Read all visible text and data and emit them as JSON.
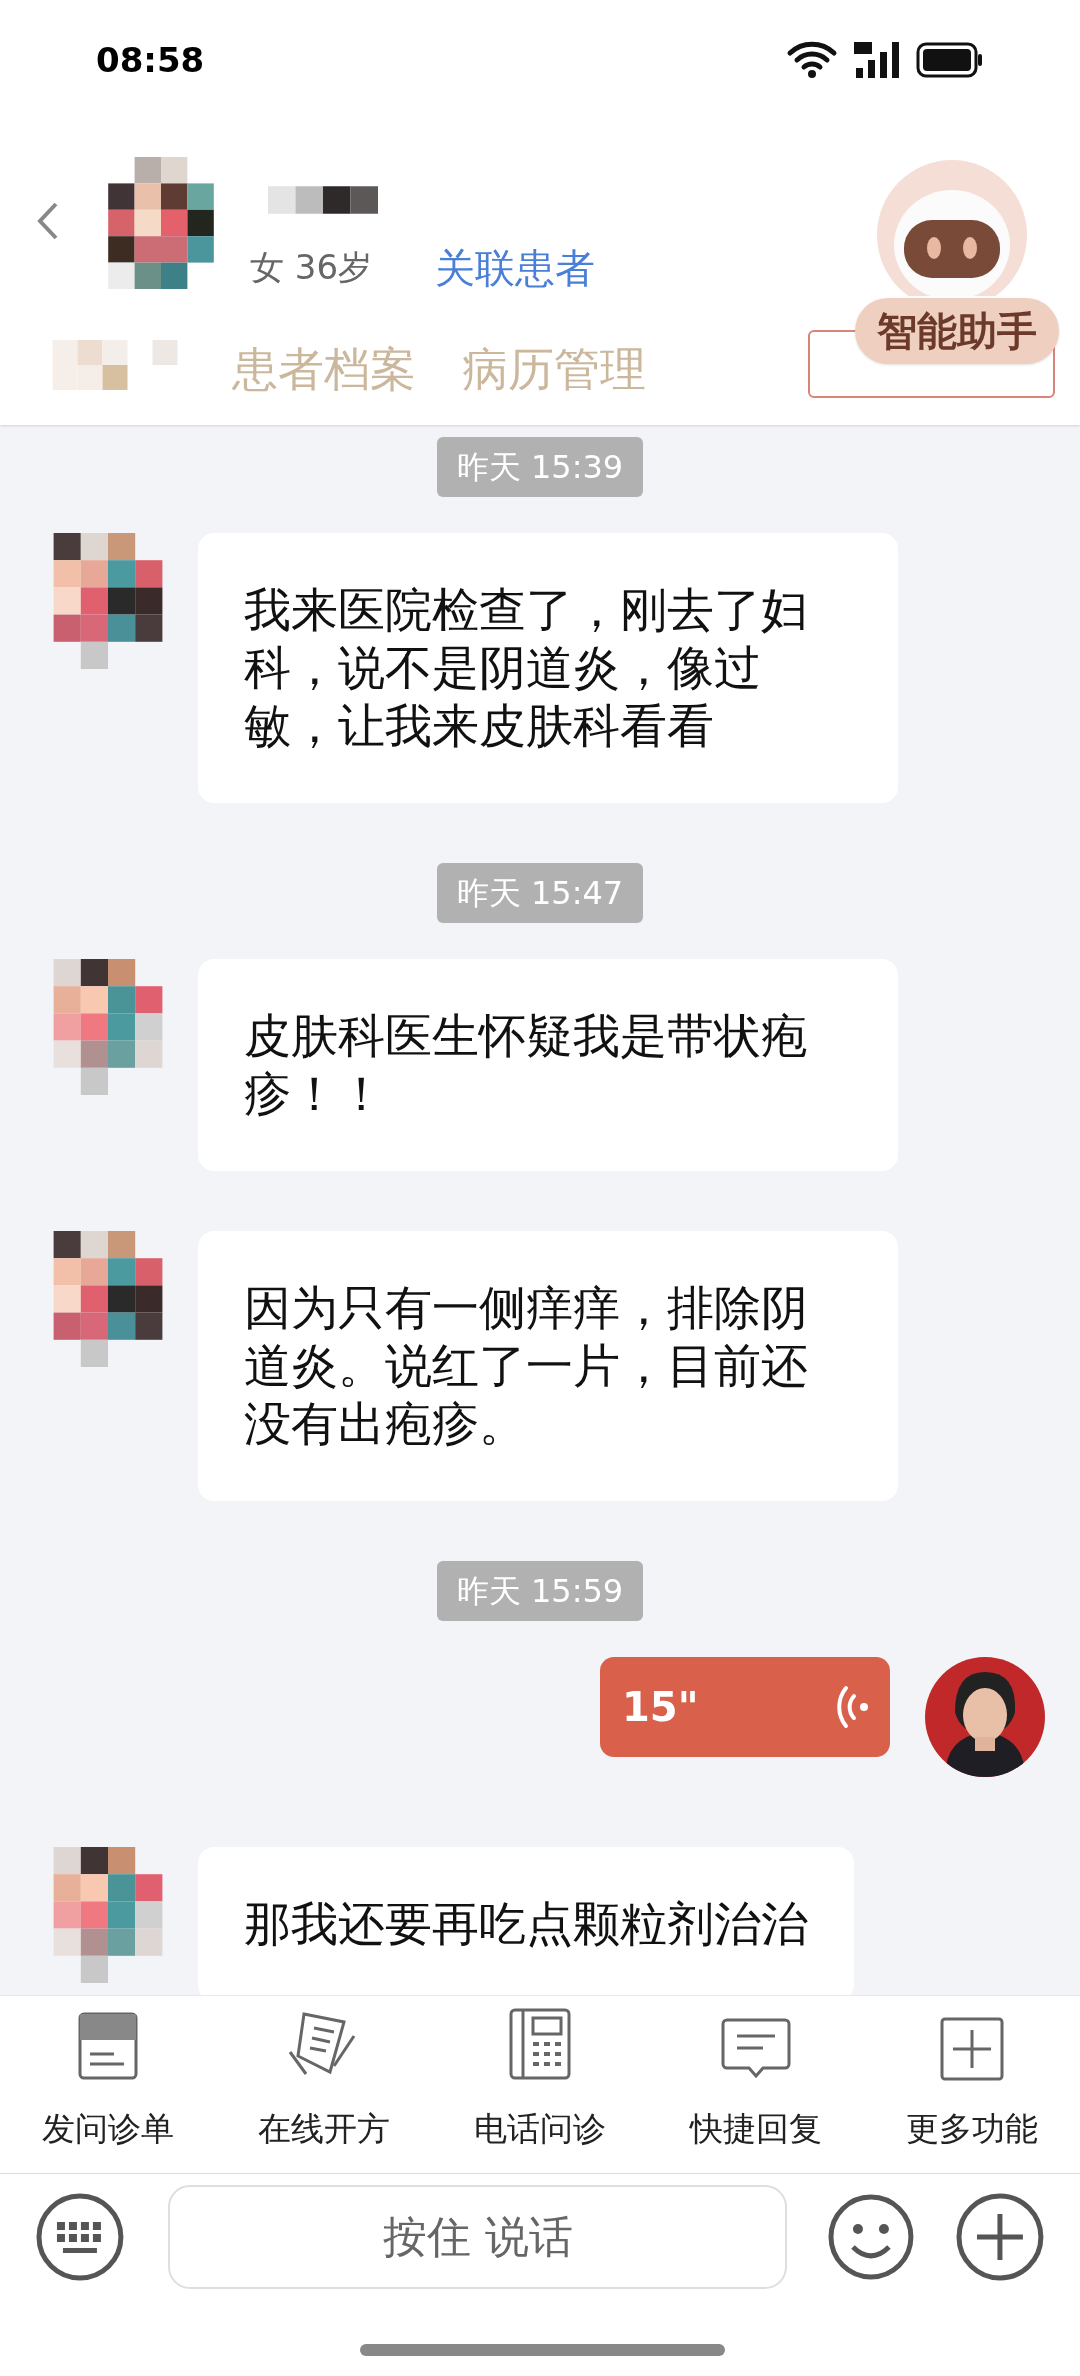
{
  "status_bar": {
    "time": "08:58"
  },
  "header": {
    "patient_info": "女 36岁",
    "link": "关联患者",
    "assistant": "智能助手",
    "tabs": [
      {
        "label": "患者档案",
        "selected": false
      },
      {
        "label": "病历管理",
        "selected": false
      }
    ]
  },
  "messages": [
    {
      "kind": "time",
      "text": "昨天 15:39"
    },
    {
      "kind": "incoming",
      "text": "我来医院检查了，刚去了妇科，说不是阴道炎，像过敏，让我来皮肤科看看"
    },
    {
      "kind": "time",
      "text": "昨天 15:47"
    },
    {
      "kind": "incoming",
      "text": "皮肤科医生怀疑我是带状疱疹！！"
    },
    {
      "kind": "incoming",
      "text": "因为只有一侧痒痒，排除阴道炎。说红了一片，目前还没有出疱疹。"
    },
    {
      "kind": "time",
      "text": "昨天 15:59"
    },
    {
      "kind": "voice",
      "text": "15\""
    },
    {
      "kind": "incoming",
      "text": "那我还要再吃点颗粒剂治治"
    }
  ],
  "toolbar": [
    {
      "kind": "form",
      "label": "发问诊单"
    },
    {
      "kind": "prescription",
      "label": "在线开方"
    },
    {
      "kind": "phone",
      "label": "电话问诊"
    },
    {
      "kind": "reply",
      "label": "快捷回复"
    },
    {
      "kind": "more",
      "label": "更多功能"
    }
  ],
  "input": {
    "placeholder": "按住 说话"
  }
}
